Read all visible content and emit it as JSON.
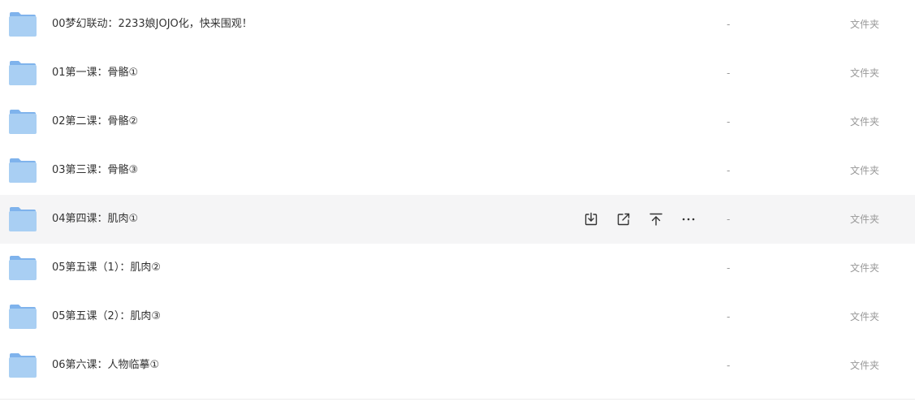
{
  "colors": {
    "folder_back": "#7fb3ec",
    "folder_front": "#a9cff3",
    "hover_bg": "#f5f5f6",
    "muted_text": "#999999",
    "icon_stroke": "#333333"
  },
  "rows": [
    {
      "name": "00梦幻联动：2233娘JOJO化，快来围观！",
      "size": "-",
      "type": "文件夹",
      "icon": "folder-icon"
    },
    {
      "name": "01第一课：骨骼①",
      "size": "-",
      "type": "文件夹",
      "icon": "folder-icon"
    },
    {
      "name": "02第二课：骨骼②",
      "size": "-",
      "type": "文件夹",
      "icon": "folder-icon"
    },
    {
      "name": "03第三课：骨骼③",
      "size": "-",
      "type": "文件夹",
      "icon": "folder-icon"
    },
    {
      "name": "04第四课：肌肉①",
      "size": "-",
      "type": "文件夹",
      "icon": "folder-icon",
      "hovered": true
    },
    {
      "name": "05第五课（1）：肌肉②",
      "size": "-",
      "type": "文件夹",
      "icon": "folder-icon"
    },
    {
      "name": "05第五课（2）：肌肉③",
      "size": "-",
      "type": "文件夹",
      "icon": "folder-icon"
    },
    {
      "name": "06第六课：人物临摹①",
      "size": "-",
      "type": "文件夹",
      "icon": "folder-icon"
    }
  ],
  "row_actions": [
    {
      "icon": "download-icon"
    },
    {
      "icon": "share-icon"
    },
    {
      "icon": "pin-top-icon"
    },
    {
      "icon": "more-icon"
    }
  ]
}
